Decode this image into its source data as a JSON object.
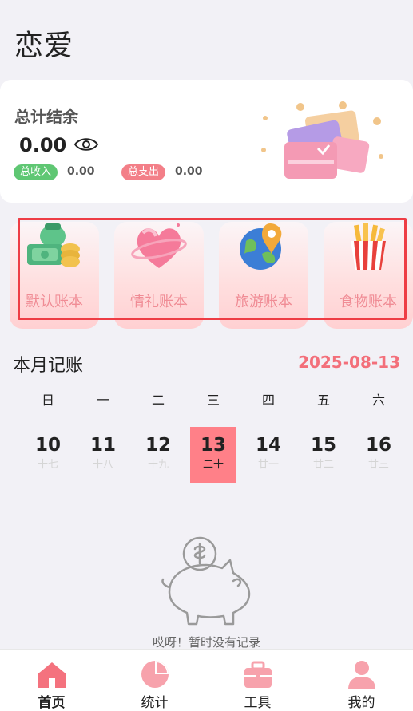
{
  "page": {
    "title": "恋爱"
  },
  "balance": {
    "label": "总计结余",
    "amount": "0.00",
    "income_label": "总收入",
    "income_value": "0.00",
    "expense_label": "总支出",
    "expense_value": "0.00",
    "eye_icon": "eye-icon",
    "illustration_icon": "credit-cards-icon"
  },
  "books": [
    {
      "label": "默认账本",
      "icon": "money-bag-icon"
    },
    {
      "label": "情礼账本",
      "icon": "heart-ring-icon"
    },
    {
      "label": "旅游账本",
      "icon": "globe-pin-icon"
    },
    {
      "label": "食物账本",
      "icon": "fries-icon"
    }
  ],
  "month": {
    "title": "本月记账",
    "date": "2025-08-13",
    "weekdays": [
      "日",
      "一",
      "二",
      "三",
      "四",
      "五",
      "六"
    ],
    "days": [
      {
        "num": "10",
        "lunar": "十七"
      },
      {
        "num": "11",
        "lunar": "十八"
      },
      {
        "num": "12",
        "lunar": "十九"
      },
      {
        "num": "13",
        "lunar": "二十",
        "selected": true
      },
      {
        "num": "14",
        "lunar": "廿一"
      },
      {
        "num": "15",
        "lunar": "廿二"
      },
      {
        "num": "16",
        "lunar": "廿三"
      }
    ]
  },
  "empty": {
    "text": "哎呀！暂时没有记录",
    "icon": "piggy-bank-icon"
  },
  "tabbar": [
    {
      "label": "首页",
      "icon": "home-icon",
      "active": true
    },
    {
      "label": "统计",
      "icon": "pie-chart-icon"
    },
    {
      "label": "工具",
      "icon": "toolbox-icon"
    },
    {
      "label": "我的",
      "icon": "user-icon"
    }
  ],
  "colors": {
    "accent": "#ff8088",
    "accent_text": "#f36f7a",
    "income": "#5fc773",
    "expense": "#f37f88",
    "highlight": "#ee3d45"
  }
}
